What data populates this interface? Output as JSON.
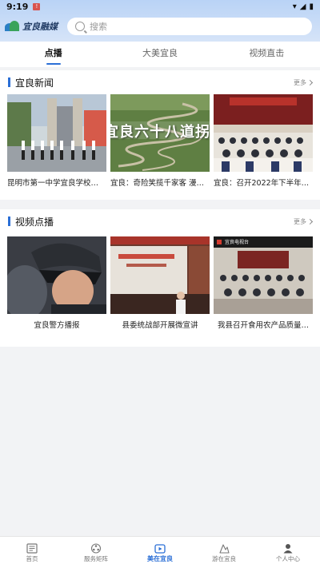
{
  "status": {
    "time": "9:19",
    "alert": "!"
  },
  "header": {
    "logo_text": "宜良融媒",
    "search_placeholder": "搜索"
  },
  "tabs": [
    {
      "label": "点播",
      "active": true
    },
    {
      "label": "大美宜良",
      "active": false
    },
    {
      "label": "视频直击",
      "active": false
    }
  ],
  "news": {
    "title": "宜良新闻",
    "more": "更多",
    "items": [
      {
        "title": "昆明市第一中学宜良学校…",
        "image": "school-gate-photo"
      },
      {
        "title": "宜良：奇险笑揽千家客 漫…",
        "image": "winding-road-photo",
        "overlay": "宜良六十八道拐"
      },
      {
        "title": "宜良：召开2022年下半年…",
        "image": "meeting-hall-photo"
      }
    ]
  },
  "video": {
    "title": "视频点播",
    "more": "更多",
    "items": [
      {
        "title": "宜良警方播报",
        "image": "police-helmet-photo"
      },
      {
        "title": "县委统战部开展微宣讲",
        "image": "lecture-photo"
      },
      {
        "title": "我县召开食用农产品质量…",
        "image": "conference-photo",
        "overlay": "宜良电视台"
      }
    ]
  },
  "bottom_nav": [
    {
      "label": "首页",
      "icon": "newspaper-icon",
      "active": false
    },
    {
      "label": "服务矩阵",
      "icon": "matrix-icon",
      "active": false
    },
    {
      "label": "美在宜良",
      "icon": "video-icon",
      "active": true
    },
    {
      "label": "游在宜良",
      "icon": "travel-icon",
      "active": false
    },
    {
      "label": "个人中心",
      "icon": "person-icon",
      "active": false
    }
  ],
  "colors": {
    "accent": "#2b6fd6",
    "header_gradient_top": "#b9d3f6",
    "page_bg": "#f2f3f5"
  }
}
